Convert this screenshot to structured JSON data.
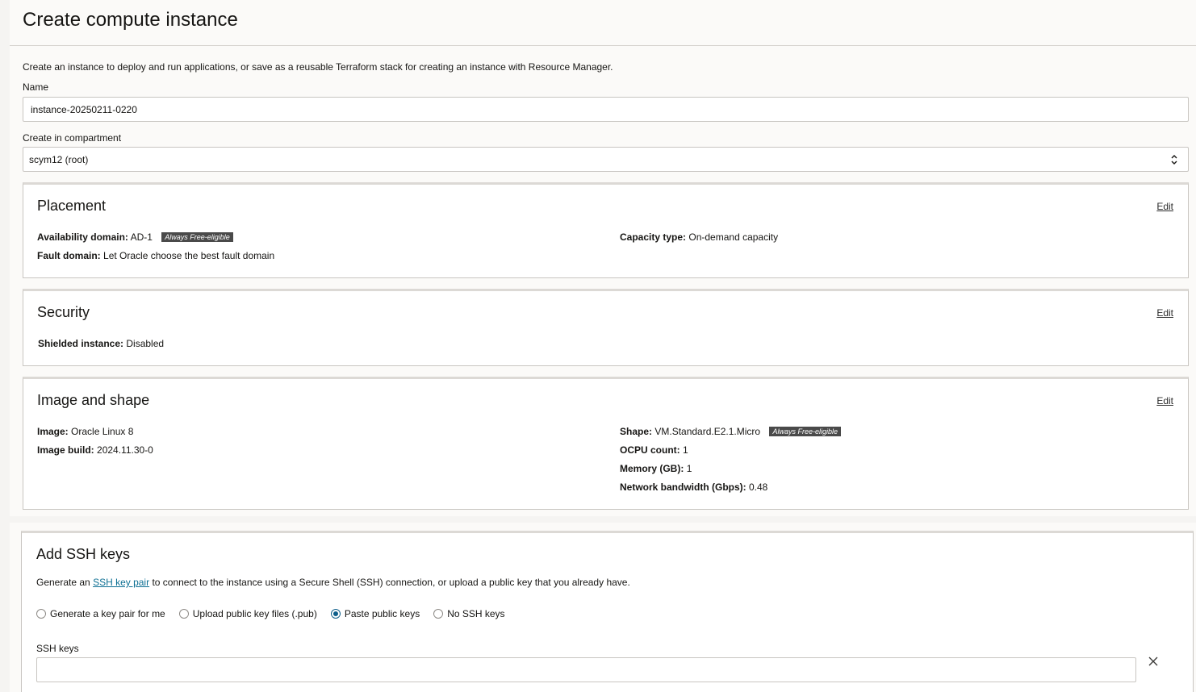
{
  "page": {
    "title": "Create compute instance",
    "intro": "Create an instance to deploy and run applications, or save as a reusable Terraform stack for creating an instance with Resource Manager."
  },
  "name_field": {
    "label": "Name",
    "value": "instance-20250211-0220"
  },
  "compartment_field": {
    "label": "Create in compartment",
    "value": "scym12 (root)"
  },
  "placement": {
    "title": "Placement",
    "edit_label": "Edit",
    "availability_domain_label": "Availability domain:",
    "availability_domain_value": "AD-1",
    "badge": "Always Free-eligible",
    "fault_domain_label": "Fault domain:",
    "fault_domain_value": "Let Oracle choose the best fault domain",
    "capacity_type_label": "Capacity type:",
    "capacity_type_value": "On-demand capacity"
  },
  "security": {
    "title": "Security",
    "edit_label": "Edit",
    "shielded_label": "Shielded instance:",
    "shielded_value": "Disabled"
  },
  "image_shape": {
    "title": "Image and shape",
    "edit_label": "Edit",
    "image_label": "Image:",
    "image_value": "Oracle Linux 8",
    "image_build_label": "Image build:",
    "image_build_value": "2024.11.30-0",
    "shape_label": "Shape:",
    "shape_value": "VM.Standard.E2.1.Micro",
    "badge": "Always Free-eligible",
    "ocpu_label": "OCPU count:",
    "ocpu_value": "1",
    "memory_label": "Memory (GB):",
    "memory_value": "1",
    "bandwidth_label": "Network bandwidth (Gbps):",
    "bandwidth_value": "0.48"
  },
  "ssh": {
    "title": "Add SSH keys",
    "desc_prefix": "Generate an",
    "desc_link": "SSH key pair",
    "desc_suffix": "to connect to the instance using a Secure Shell (SSH) connection, or upload a public key that you already have.",
    "options": [
      {
        "label": "Generate a key pair for me",
        "checked": false
      },
      {
        "label": "Upload public key files (.pub)",
        "checked": false
      },
      {
        "label": "Paste public keys",
        "checked": true
      },
      {
        "label": "No SSH keys",
        "checked": false
      }
    ],
    "keys_label": "SSH keys",
    "keys_value": ""
  },
  "icons": {
    "compartment_select": "chevron-up-down-icon",
    "clear": "close-icon"
  },
  "colors": {
    "link": "#0d6f93",
    "radio_selected": "#0d5e8a",
    "badge_bg": "#4a4a4a"
  }
}
